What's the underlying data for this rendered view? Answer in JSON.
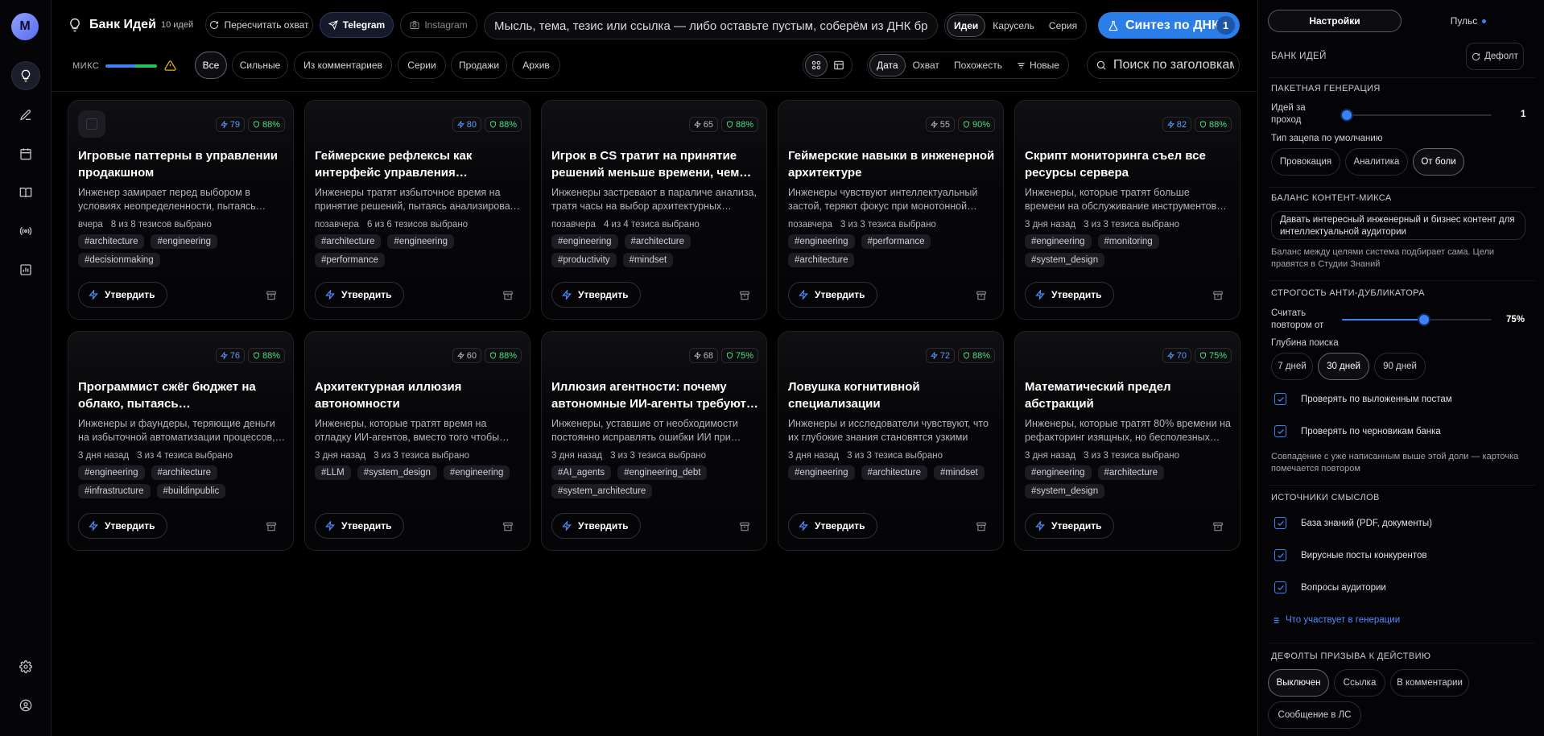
{
  "rail": {
    "avatar": "M"
  },
  "header": {
    "title": "Банк Идей",
    "count": "10 идей",
    "recalc_label": "Пересчитать охват",
    "telegram_label": "Telegram",
    "instagram_label": "Instagram",
    "input_placeholder": "Мысль, тема, тезис или ссылка — либо оставьте пустым, соберём из ДНК бренда",
    "formats": [
      "Идеи",
      "Карусель",
      "Серия"
    ],
    "synth_label": "Синтез по ДНК",
    "synth_badge": "1"
  },
  "filters": {
    "mix_label": "МИКС",
    "chips": [
      "Все",
      "Сильные",
      "Из комментариев",
      "Серии",
      "Продажи",
      "Архив"
    ],
    "sort": [
      "Дата",
      "Охват",
      "Похожесть",
      "Новые"
    ],
    "search_placeholder": "Поиск по заголовкам"
  },
  "cards": [
    {
      "reach": "79",
      "reach_color": "blue",
      "score": "88%",
      "title": "Игровые паттерны в управлении продакшном",
      "desc": "Инженер замирает перед выбором в условиях неопределенности, пытаясь просчитать все варианты",
      "date": "вчера",
      "theses": "8 из 8 тезисов выбрано",
      "tags": [
        "#architecture",
        "#engineering",
        "#decisionmaking"
      ]
    },
    {
      "reach": "80",
      "reach_color": "blue",
      "score": "88%",
      "title": "Геймерские рефлексы как интерфейс управления системами",
      "desc": "Инженеры тратят избыточное время на принятие решений, пытаясь анализировать все варианты",
      "date": "позавчера",
      "theses": "6 из 6 тезисов выбрано",
      "tags": [
        "#architecture",
        "#engineering",
        "#performance"
      ]
    },
    {
      "reach": "65",
      "reach_color": "grey",
      "score": "88%",
      "title": "Игрок в CS тратит на принятие решений меньше времени, чем инженер",
      "desc": "Инженеры застревают в параличе анализа, тратя часы на выбор архитектурных решений",
      "date": "позавчера",
      "theses": "4 из 4 тезиса выбрано",
      "tags": [
        "#engineering",
        "#architecture",
        "#productivity",
        "#mindset"
      ]
    },
    {
      "reach": "55",
      "reach_color": "grey",
      "score": "90%",
      "title": "Геймерские навыки в инженерной архитектуре",
      "desc": "Инженеры чувствуют интеллектуальный застой, теряют фокус при монотонной работе",
      "date": "позавчера",
      "theses": "3 из 3 тезиса выбрано",
      "tags": [
        "#engineering",
        "#performance",
        "#architecture"
      ]
    },
    {
      "reach": "82",
      "reach_color": "blue",
      "score": "88%",
      "title": "Скрипт мониторинга съел все ресурсы сервера",
      "desc": "Инженеры, которые тратят больше времени на обслуживание инструментов контроля, чем на продукт",
      "date": "3 дня назад",
      "theses": "3 из 3 тезиса выбрано",
      "tags": [
        "#engineering",
        "#monitoring",
        "#system_design"
      ]
    },
    {
      "reach": "76",
      "reach_color": "blue",
      "score": "88%",
      "title": "Программист сжёг бюджет на облако, пытаясь автоматизировать всё",
      "desc": "Инженеры и фаундеры, теряющие деньги на избыточной автоматизации процессов, которые не нужны",
      "date": "3 дня назад",
      "theses": "3 из 4 тезиса выбрано",
      "tags": [
        "#engineering",
        "#architecture",
        "#infrastructure",
        "#buildinpublic"
      ]
    },
    {
      "reach": "60",
      "reach_color": "grey",
      "score": "88%",
      "title": "Архитектурная иллюзия автономности",
      "desc": "Инженеры, которые тратят время на отладку ИИ-агентов, вместо того чтобы строить систему",
      "date": "3 дня назад",
      "theses": "3 из 3 тезиса выбрано",
      "tags": [
        "#LLM",
        "#system_design",
        "#engineering"
      ]
    },
    {
      "reach": "68",
      "reach_color": "grey",
      "score": "75%",
      "title": "Иллюзия агентности: почему автономные ИИ-агенты требуют контроля",
      "desc": "Инженеры, уставшие от необходимости постоянно исправлять ошибки ИИ при генерации кода",
      "date": "3 дня назад",
      "theses": "3 из 3 тезиса выбрано",
      "tags": [
        "#AI_agents",
        "#engineering_debt",
        "#system_architecture"
      ]
    },
    {
      "reach": "72",
      "reach_color": "blue",
      "score": "88%",
      "title": "Ловушка когнитивной специализации",
      "desc": "Инженеры и исследователи чувствуют, что их глубокие знания становятся узкими",
      "date": "3 дня назад",
      "theses": "3 из 3 тезиса выбрано",
      "tags": [
        "#engineering",
        "#architecture",
        "#mindset"
      ]
    },
    {
      "reach": "70",
      "reach_color": "blue",
      "score": "75%",
      "title": "Математический предел абстракций",
      "desc": "Инженеры, которые тратят 80% времени на рефакторинг изящных, но бесполезных абстракций",
      "date": "3 дня назад",
      "theses": "3 из 3 тезиса выбрано",
      "tags": [
        "#engineering",
        "#architecture",
        "#system_design"
      ]
    }
  ],
  "card_approve_label": "Утвердить",
  "panel": {
    "tabs": [
      "Настройки",
      "Пульс"
    ],
    "bank_title": "Банк идей",
    "default_label": "Дефолт",
    "batch_title": "Пакетная генерация",
    "ideas_per_pass_label": "Идей за проход",
    "ideas_per_pass_value": "1",
    "ideas_per_pass_fraction": 0.0,
    "hook_type_label": "Тип зацепа по умолчанию",
    "hook_types": [
      "Провокация",
      "Аналитика",
      "От боли"
    ],
    "mix_title": "Баланс контент-микса",
    "mix_text": "Давать интересный инженерный и бизнес контент для интеллектуальной аудитории",
    "mix_note": "Баланс между целями система подбирает сама. Цели правятся в Студии Знаний",
    "dup_title": "Строгость анти-дубликатора",
    "dup_label": "Считать повтором от",
    "dup_value": "75%",
    "dup_fraction": 0.55,
    "depth_label": "Глубина поиска",
    "depths": [
      "7 дней",
      "30 дней",
      "90 дней"
    ],
    "check_posts": "Проверять по выложенным постам",
    "check_drafts": "Проверять по черновикам банка",
    "dup_note": "Совпадение с уже написанным выше этой доли — карточка помечается повтором",
    "sources_title": "Источники смыслов",
    "sources": [
      "База знаний (PDF, документы)",
      "Вирусные посты конкурентов",
      "Вопросы аудитории"
    ],
    "gen_link": "Что участвует в генерации",
    "cta_title": "Дефолты призыва к действию",
    "cta": [
      "Выключен",
      "Ссылка",
      "В комментарии",
      "Сообщение в ЛС"
    ]
  },
  "colors": {
    "accent": "#2b7de8",
    "green": "#4ade80",
    "warn": "#eab308"
  }
}
